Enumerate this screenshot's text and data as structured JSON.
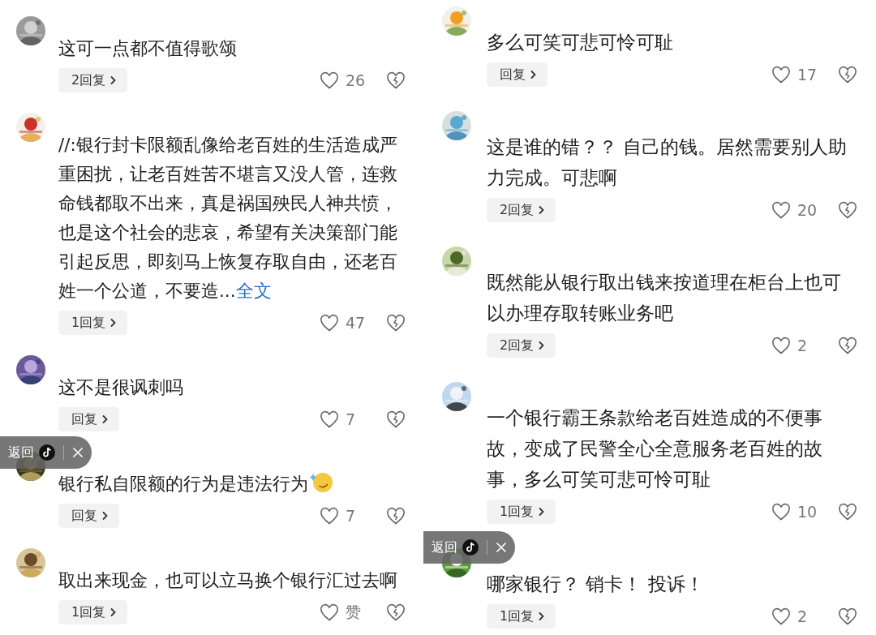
{
  "panels": [
    {
      "comments": [
        {
          "text": "这可一点都不值得歌颂",
          "reply_button": "2回复",
          "likes": "26",
          "emoji": false
        },
        {
          "text": "//:银行封卡限额乱像给老百姓的生活造成严重困扰，让老百姓苦不堪言又没人管，连救命钱都取不出来，真是祸国殃民人神共愤，也是这个社会的悲哀，希望有关决策部门能引起反思，即刻马上恢复存取自由，还老百姓一个公道，不要造...",
          "more_link": "全文",
          "reply_button": "1回复",
          "likes": "47",
          "emoji": false
        },
        {
          "text": "这不是很讽刺吗",
          "reply_button": "回复",
          "likes": "7",
          "emoji": false
        },
        {
          "text": "银行私自限额的行为是违法行为",
          "reply_button": "回复",
          "likes": "7",
          "emoji": true
        },
        {
          "text": "取出来现金，也可以立马换个银行汇过去啊",
          "reply_button": "1回复",
          "likes": "赞",
          "emoji": false
        }
      ],
      "back_overlay": {
        "label": "返回"
      }
    },
    {
      "comments": [
        {
          "text": "多么可笑可悲可怜可耻",
          "reply_button": "回复",
          "likes": "17",
          "emoji": false
        },
        {
          "text": "这是谁的错？？ 自己的钱。居然需要别人助力完成。可悲啊",
          "reply_button": "2回复",
          "likes": "20",
          "emoji": false
        },
        {
          "text": "既然能从银行取出钱来按道理在柜台上也可以办理存取转账业务吧",
          "reply_button": "2回复",
          "likes": "2",
          "emoji": false
        },
        {
          "text": "一个银行霸王条款给老百姓造成的不便事故，变成了民警全心全意服务老百姓的故事，多么可笑可悲可怜可耻",
          "reply_button": "1回复",
          "likes": "10",
          "emoji": false
        },
        {
          "text": "哪家银行？ 销卡！ 投诉！",
          "reply_button": "1回复",
          "likes": "2",
          "emoji": false
        }
      ],
      "back_overlay": {
        "label": "返回"
      }
    }
  ]
}
